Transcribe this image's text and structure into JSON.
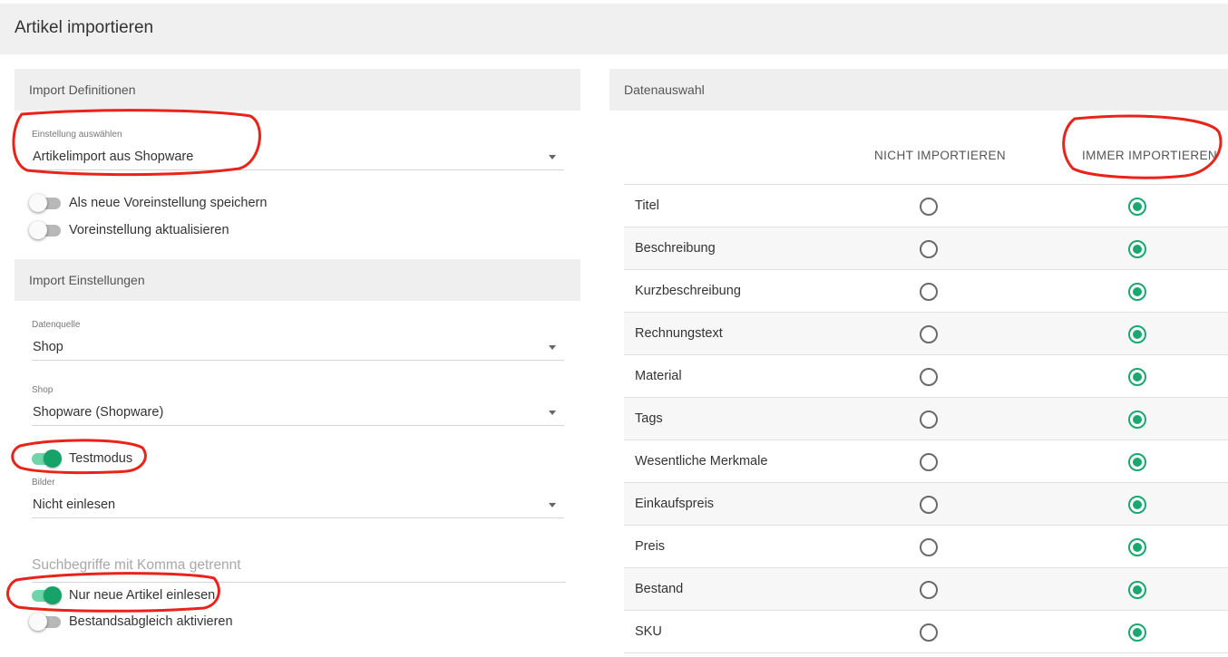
{
  "page": {
    "title": "Artikel importieren"
  },
  "import_definitions": {
    "heading": "Import Definitionen",
    "setting_select": {
      "label": "Einstellung auswählen",
      "value": "Artikelimport aus Shopware"
    },
    "toggles": [
      {
        "label": "Als neue Voreinstellung speichern",
        "on": false
      },
      {
        "label": "Voreinstellung aktualisieren",
        "on": false
      }
    ]
  },
  "import_settings": {
    "heading": "Import Einstellungen",
    "datasource": {
      "label": "Datenquelle",
      "value": "Shop"
    },
    "shop": {
      "label": "Shop",
      "value": "Shopware (Shopware)"
    },
    "testmode": {
      "label": "Testmodus",
      "on": true
    },
    "images": {
      "label": "Bilder",
      "value": "Nicht einlesen"
    },
    "search": {
      "placeholder": "Suchbegriffe mit Komma getrennt",
      "value": ""
    },
    "only_new": {
      "label": "Nur neue Artikel einlesen",
      "on": true
    },
    "stock_sync": {
      "label": "Bestandsabgleich aktivieren",
      "on": false
    }
  },
  "data_selection": {
    "heading": "Datenauswahl",
    "columns": [
      "NICHT IMPORTIEREN",
      "IMMER IMPORTIEREN"
    ],
    "rows": [
      {
        "label": "Titel",
        "selected": "IMMER IMPORTIEREN"
      },
      {
        "label": "Beschreibung",
        "selected": "IMMER IMPORTIEREN"
      },
      {
        "label": "Kurzbeschreibung",
        "selected": "IMMER IMPORTIEREN"
      },
      {
        "label": "Rechnungstext",
        "selected": "IMMER IMPORTIEREN"
      },
      {
        "label": "Material",
        "selected": "IMMER IMPORTIEREN"
      },
      {
        "label": "Tags",
        "selected": "IMMER IMPORTIEREN"
      },
      {
        "label": "Wesentliche Merkmale",
        "selected": "IMMER IMPORTIEREN"
      },
      {
        "label": "Einkaufspreis",
        "selected": "IMMER IMPORTIEREN"
      },
      {
        "label": "Preis",
        "selected": "IMMER IMPORTIEREN"
      },
      {
        "label": "Bestand",
        "selected": "IMMER IMPORTIEREN"
      },
      {
        "label": "SKU",
        "selected": "IMMER IMPORTIEREN"
      }
    ]
  },
  "colors": {
    "accent": "#1aa870",
    "toggle_track_on": "#6fd4a8",
    "annotation": "#e8231a"
  }
}
